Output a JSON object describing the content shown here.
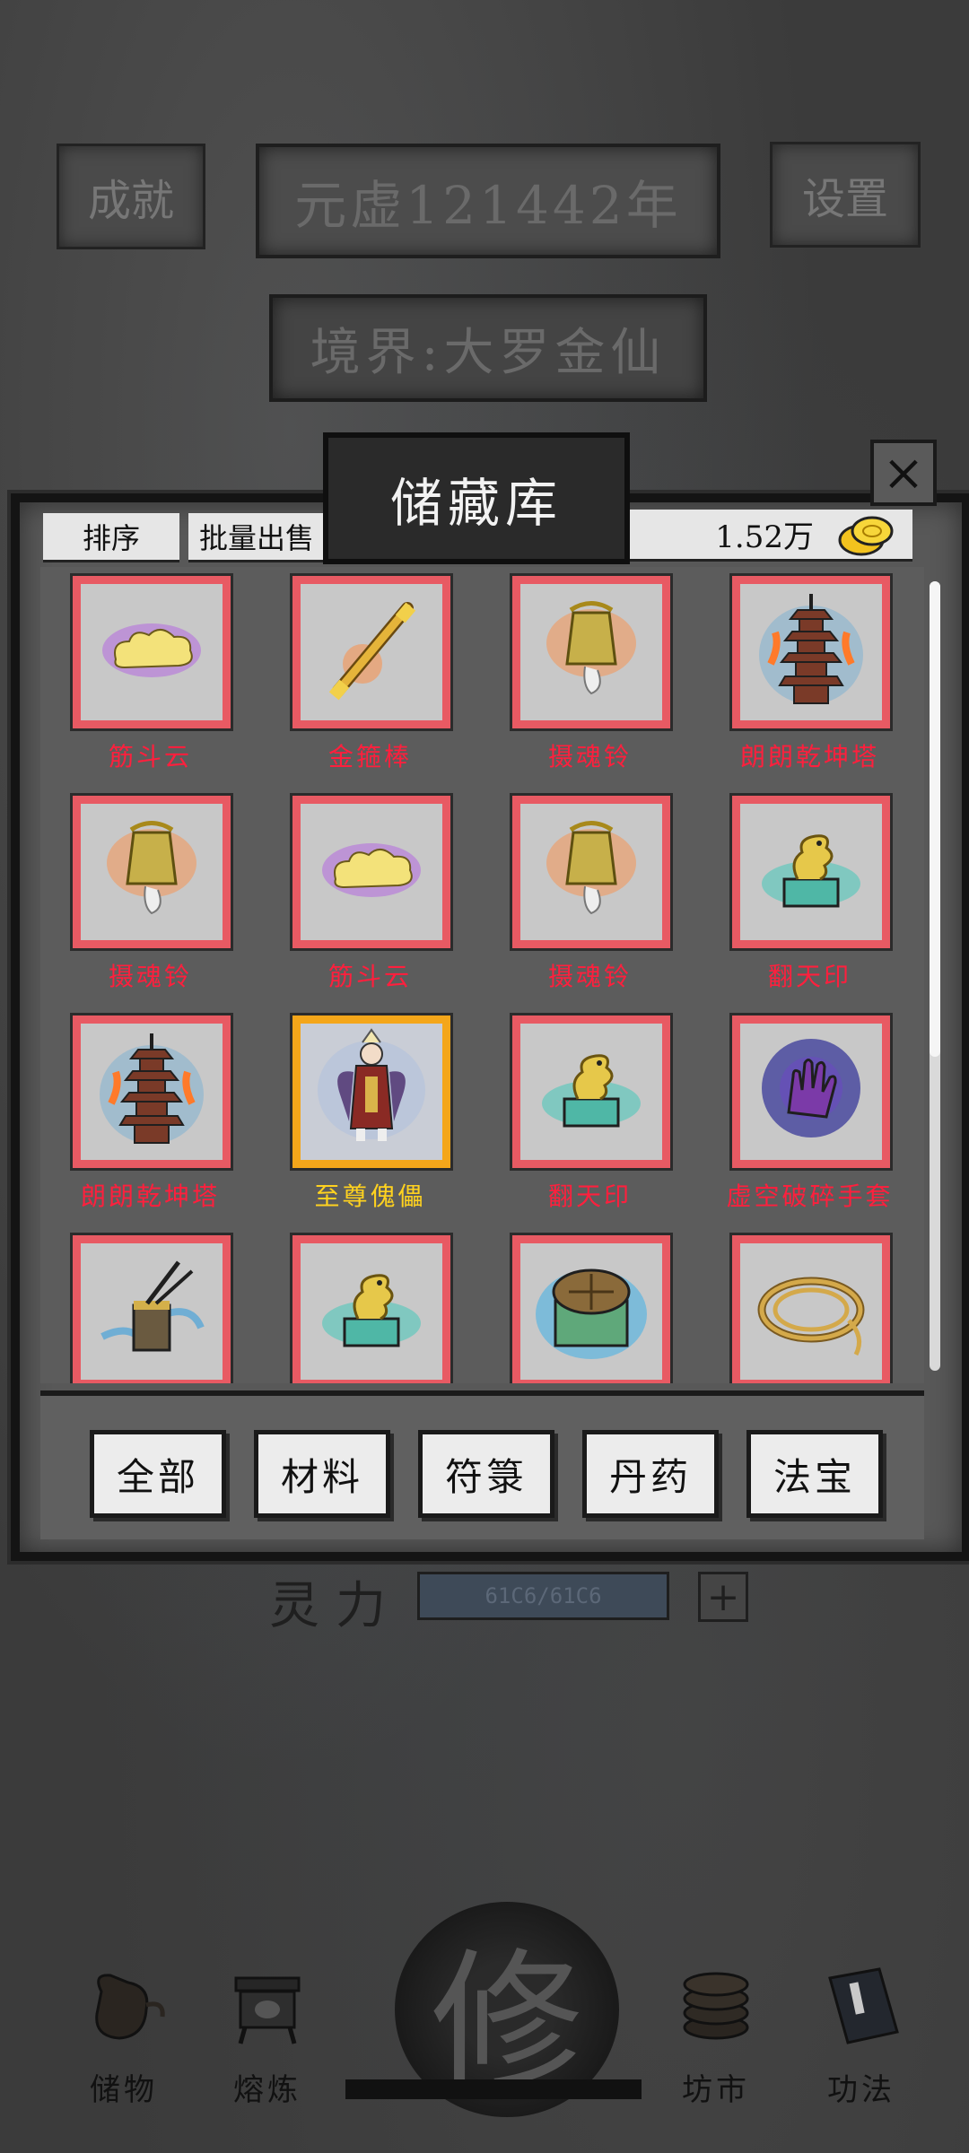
{
  "hud": {
    "achievement_label": "成就",
    "settings_label": "设置",
    "year_text": "元虚121442年",
    "realm_text": "境界:大罗金仙",
    "spirit_label": "灵力",
    "spirit_value": "61C6/61C6",
    "spirit_plus": "+"
  },
  "storage": {
    "title": "储藏库",
    "close_symbol": "×",
    "sort_label": "排序",
    "bulk_sell_label": "批量出售",
    "currency_amount": "1.52万",
    "items": [
      {
        "name": "筋斗云",
        "icon": "cloud-icon",
        "rarity": "red"
      },
      {
        "name": "金箍棒",
        "icon": "golden-staff-icon",
        "rarity": "red"
      },
      {
        "name": "摄魂铃",
        "icon": "soul-bell-icon",
        "rarity": "red"
      },
      {
        "name": "朗朗乾坤塔",
        "icon": "pagoda-icon",
        "rarity": "red"
      },
      {
        "name": "摄魂铃",
        "icon": "soul-bell-icon",
        "rarity": "red"
      },
      {
        "name": "筋斗云",
        "icon": "cloud-icon",
        "rarity": "red"
      },
      {
        "name": "摄魂铃",
        "icon": "soul-bell-icon",
        "rarity": "red"
      },
      {
        "name": "翻天印",
        "icon": "dragon-seal-icon",
        "rarity": "red"
      },
      {
        "name": "朗朗乾坤塔",
        "icon": "pagoda-icon",
        "rarity": "red"
      },
      {
        "name": "至尊傀儡",
        "icon": "puppet-icon",
        "rarity": "gold"
      },
      {
        "name": "翻天印",
        "icon": "dragon-seal-icon",
        "rarity": "red"
      },
      {
        "name": "虚空破碎手套",
        "icon": "void-glove-icon",
        "rarity": "red"
      },
      {
        "name": "",
        "icon": "pen-holder-icon",
        "rarity": "red"
      },
      {
        "name": "",
        "icon": "dragon-seal-icon",
        "rarity": "red"
      },
      {
        "name": "",
        "icon": "turtle-chest-icon",
        "rarity": "red"
      },
      {
        "name": "",
        "icon": "rope-icon",
        "rarity": "red"
      }
    ],
    "filters": [
      "全部",
      "材料",
      "符箓",
      "丹药",
      "法宝"
    ]
  },
  "nav": {
    "items": [
      {
        "label": "储物",
        "icon": "bag-icon"
      },
      {
        "label": "熔炼",
        "icon": "furnace-icon"
      },
      {
        "label": "修",
        "icon": "cultivate-seal-icon"
      },
      {
        "label": "坊市",
        "icon": "coins-icon"
      },
      {
        "label": "功法",
        "icon": "book-icon"
      }
    ]
  },
  "colors": {
    "rarity_red": "#e85a63",
    "rarity_gold": "#f4a61a",
    "name_red": "#ff1f3d",
    "name_gold": "#ffd21f"
  }
}
